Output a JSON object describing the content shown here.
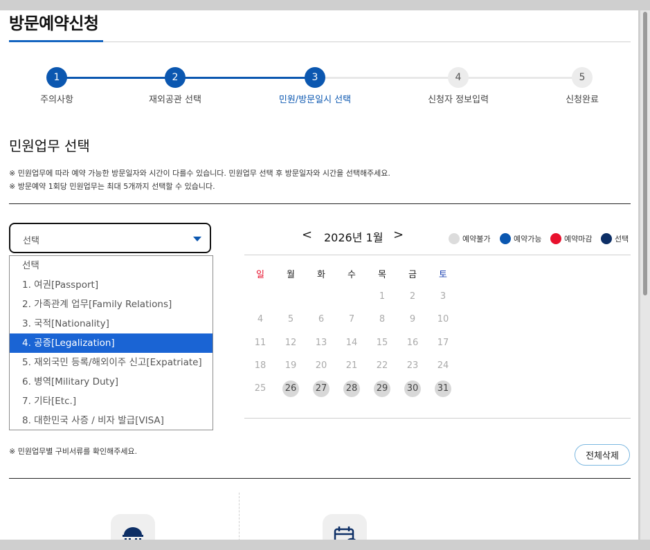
{
  "page_title": "방문예약신청",
  "steps": [
    {
      "num": "1",
      "label": "주의사항",
      "state": "done"
    },
    {
      "num": "2",
      "label": "재외공관 선택",
      "state": "done"
    },
    {
      "num": "3",
      "label": "민원/방문일시 선택",
      "state": "active"
    },
    {
      "num": "4",
      "label": "신청자 정보입력",
      "state": "todo"
    },
    {
      "num": "5",
      "label": "신청완료",
      "state": "todo"
    }
  ],
  "section_title": "민원업무 선택",
  "notices": [
    "※ 민원업무에 따라 예약 가능한 방문일자와 시간이 다를수 있습니다. 민원업무 선택 후 방문일자와 시간을 선택해주세요.",
    "※ 방문예약 1회당 민원업무는 최대 5개까지 선택할 수 있습니다."
  ],
  "select": {
    "value": "선택",
    "options": [
      "선택",
      "1. 여권[Passport]",
      "2. 가족관계 업무[Family Relations]",
      "3. 국적[Nationality]",
      "4. 공증[Legalization]",
      "5. 재외국민 등록/해외이주 신고[Expatriate]",
      "6. 병역[Military Duty]",
      "7. 기타[Etc.]",
      "8. 대한민국 사증 / 비자 발급[VISA]"
    ],
    "highlighted_index": 4
  },
  "calendar": {
    "prev": "<",
    "next": ">",
    "title": "2026년 1월",
    "weekdays": [
      "일",
      "월",
      "화",
      "수",
      "목",
      "금",
      "토"
    ],
    "weeks": [
      [
        "",
        "",
        "",
        "",
        "1",
        "2",
        "3"
      ],
      [
        "4",
        "5",
        "6",
        "7",
        "8",
        "9",
        "10"
      ],
      [
        "11",
        "12",
        "13",
        "14",
        "15",
        "16",
        "17"
      ],
      [
        "18",
        "19",
        "20",
        "21",
        "22",
        "23",
        "24"
      ],
      [
        "25",
        "26",
        "27",
        "28",
        "29",
        "30",
        "31"
      ]
    ],
    "available_days": [
      "26",
      "27",
      "28",
      "29",
      "30",
      "31"
    ]
  },
  "legend": [
    {
      "label": "예약불가",
      "color": "#dcdcdc"
    },
    {
      "label": "예약가능",
      "color": "#0b57b0"
    },
    {
      "label": "예약마감",
      "color": "#e8112d"
    },
    {
      "label": "선택",
      "color": "#0d2f66"
    }
  ],
  "colors": {
    "accent": "#0b57b0",
    "sunday": "#e8112d",
    "saturday": "#1a3fb0",
    "dropdown_highlight": "#1a64d4"
  },
  "docs_notice": "※ 민원업무별 구비서류를 확인해주세요.",
  "clear_all_label": "전체삭제",
  "icons": [
    "embassy-building-icon",
    "calendar-clock-icon"
  ]
}
